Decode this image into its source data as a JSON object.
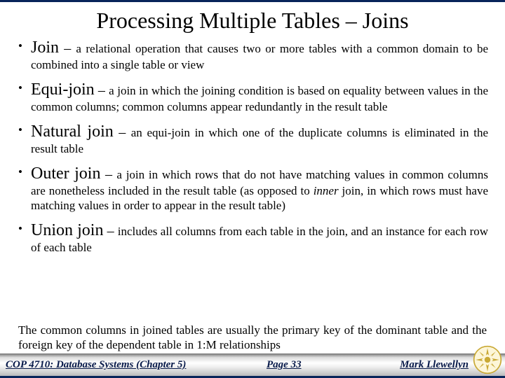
{
  "title": "Processing Multiple Tables – Joins",
  "bullets": [
    {
      "term": "Join",
      "dash": " – ",
      "desc": "a relational operation that causes two or more tables with a common domain to be combined into a single table or view"
    },
    {
      "term": "Equi-join",
      "dash": " – ",
      "desc": "a join in which the joining condition is based on equality between values in the common columns; common columns appear redundantly in the result table"
    },
    {
      "term": "Natural join",
      "dash": " – ",
      "desc": "an equi-join in which one of the duplicate columns is eliminated in the result table"
    },
    {
      "term": "Outer join",
      "dash": " – ",
      "desc_pre": "a join in which rows that do not have matching values in common columns are nonetheless included in the result table (as opposed to ",
      "desc_em": "inner",
      "desc_post": " join, in which rows must have matching values in order to appear in the result table)"
    },
    {
      "term": "Union join",
      "dash": " – ",
      "desc": "includes all columns from each table in the join, and an instance for each row of each table"
    }
  ],
  "note": "The common columns in joined tables are usually the primary key of the dominant table and the foreign key of the dependent table in 1:M relationships",
  "footer": {
    "course": "COP 4710: Database Systems (Chapter 5)",
    "page": "Page 33",
    "author": "Mark Llewellyn"
  }
}
